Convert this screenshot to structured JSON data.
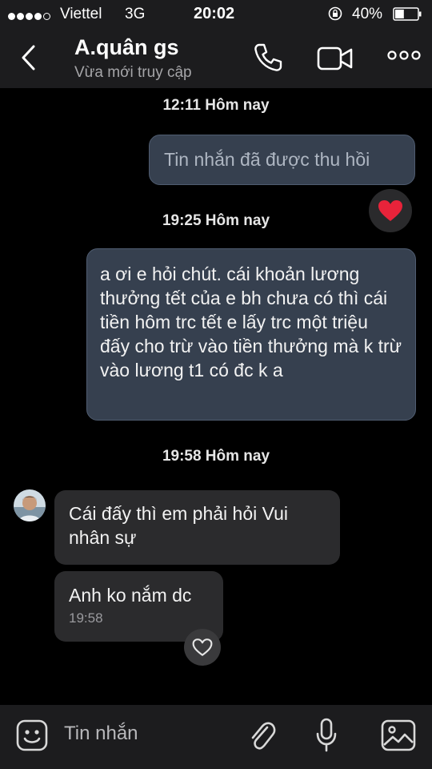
{
  "status_bar": {
    "carrier": "Viettel",
    "network": "3G",
    "time": "20:02",
    "battery": "40%",
    "battery_level": 0.4
  },
  "header": {
    "contact_name": "A.quân gs",
    "contact_status": "Vừa mới truy cập"
  },
  "messages": {
    "ts1": "12:11 Hôm nay",
    "recalled_text": "Tin nhắn đã được thu hồi",
    "ts2": "19:25 Hôm nay",
    "outgoing_text": "a ơi e hỏi chút. cái khoản lương thưởng tết của e bh chưa có thì cái tiền hôm trc tết e lấy trc một triệu đấy cho trừ vào tiền thưởng mà k trừ vào lương t1 có đc k a",
    "ts3": "19:58 Hôm nay",
    "incoming_1": "Cái đấy thì em phải hỏi Vui nhân sự",
    "incoming_2": "Anh ko nắm dc",
    "incoming_2_time": "19:58"
  },
  "composer": {
    "placeholder": "Tin nhắn"
  },
  "colors": {
    "outgoing_bubble": "#36404f",
    "incoming_bubble": "#2b2b2d",
    "heart": "#e8233a"
  },
  "icons": [
    "back-icon",
    "phone-icon",
    "video-camera-icon",
    "more-icon",
    "heart-icon",
    "heart-outline-icon",
    "emoji-icon",
    "attachment-icon",
    "microphone-icon",
    "image-icon"
  ]
}
